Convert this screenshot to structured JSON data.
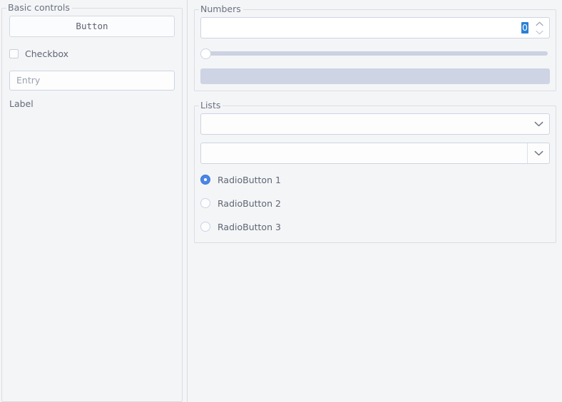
{
  "theme": {
    "background": "#f4f5f7",
    "accent": "#4a86e8",
    "selection": "#2a7fd4",
    "border": "#ccd4e1",
    "groupbox_border": "#dadde2",
    "text": "#5f6673",
    "trough": "#ced4e4"
  },
  "left_pane": {
    "groupbox_title": "Basic controls",
    "button": {
      "label": "Button"
    },
    "checkbox": {
      "label": "Checkbox",
      "checked": false
    },
    "entry": {
      "value": "",
      "placeholder": "Entry"
    },
    "label": {
      "text": "Label"
    }
  },
  "right_pane": {
    "numbers": {
      "groupbox_title": "Numbers",
      "spinbox": {
        "value": "0",
        "selected": true
      },
      "slider": {
        "value": 0,
        "min": 0,
        "max": 100
      },
      "progressbar": {
        "value": 0,
        "min": 0,
        "max": 100
      }
    },
    "lists": {
      "groupbox_title": "Lists",
      "combobox": {
        "value": "",
        "placeholder": ""
      },
      "editable_combobox": {
        "value": "",
        "placeholder": ""
      },
      "radios": [
        {
          "label": "RadioButton 1",
          "checked": true
        },
        {
          "label": "RadioButton 2",
          "checked": false
        },
        {
          "label": "RadioButton 3",
          "checked": false
        }
      ]
    }
  },
  "icons": {
    "spin_up": "chevron-up-icon",
    "spin_down": "chevron-down-icon",
    "combo_arrow": "chevron-down-icon"
  }
}
